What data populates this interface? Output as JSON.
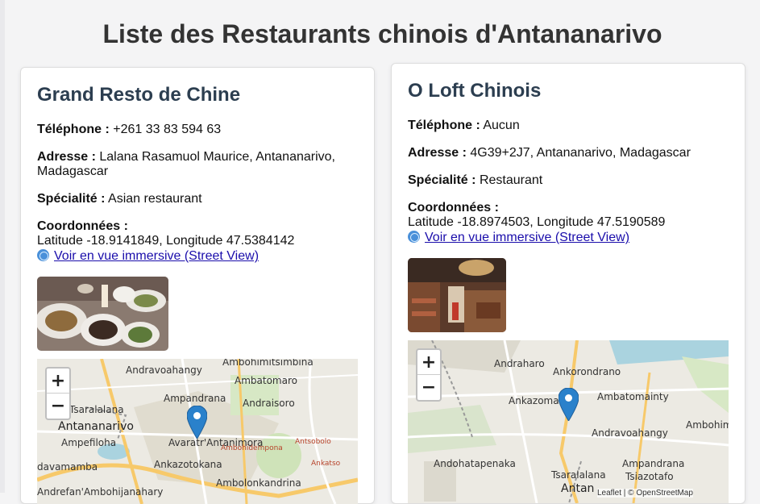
{
  "page": {
    "title": "Liste des Restaurants chinois d'Antananarivo"
  },
  "restaurants": [
    {
      "name": "Grand Resto de Chine",
      "phone_label": "Téléphone :",
      "phone": "+261 33 83 594 63",
      "address_label": "Adresse :",
      "address_line1": "Lalana Rasamuol Maurice, Antananarivo,",
      "address_line2": "Madagascar",
      "specialty_label": "Spécialité :",
      "specialty": "Asian restaurant",
      "coords_label": "Coordonnées :",
      "coords": "Latitude -18.9141849, Longitude 47.5384142",
      "streetview_label": "Voir en vue immersive (Street View)",
      "map_labels": [
        "Ambohimitsimbina",
        "Andravoahangy",
        "Ambatomaro",
        "Tsaralalana",
        "Ampandrana",
        "Andraisoro",
        "Antananarivo",
        "Avaratr'Antanimora",
        "Antsobolo",
        "Ampefiloha",
        "Ankazotokana",
        "Ambohidempona",
        "Ankatso",
        "davamamba",
        "Ambolonkandrina",
        "Andrefan'Ambohijanahary"
      ]
    },
    {
      "name": "O Loft Chinois",
      "phone_label": "Téléphone :",
      "phone": "Aucun",
      "address_label": "Adresse :",
      "address_line1": "4G39+2J7, Antananarivo, Madagascar",
      "specialty_label": "Spécialité :",
      "specialty": "Restaurant",
      "coords_label": "Coordonnées :",
      "coords": "Latitude -18.8974503, Longitude 47.5190589",
      "streetview_label": "Voir en vue immersive (Street View)",
      "map_labels": [
        "Andraharo",
        "Ankorondrano",
        "Ankazomanga",
        "Ambatomainty",
        "Ambohimitsimbina",
        "Andravoahangy",
        "Andohatapenaka",
        "Ampandrana",
        "Tsiazotafo",
        "Tsaralalana",
        "Antan"
      ],
      "attribution": "Leaflet | © OpenStreetMap"
    }
  ],
  "map_controls": {
    "zoom_in": "+",
    "zoom_out": "−"
  },
  "colors": {
    "title": "#333333",
    "heading": "#2c3e50",
    "link": "#1a0dab",
    "marker": "#2a81cb"
  }
}
